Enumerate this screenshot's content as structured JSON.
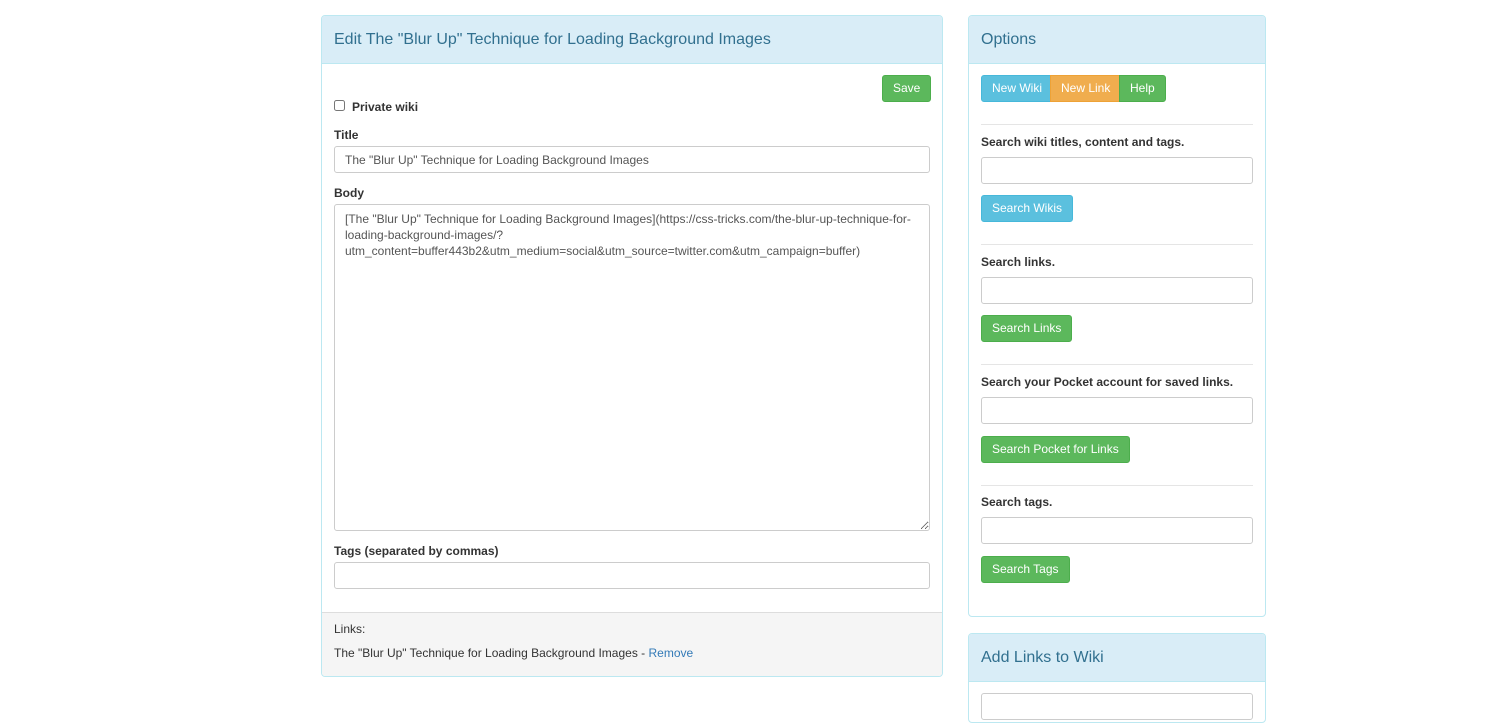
{
  "edit_panel": {
    "heading": "Edit The \"Blur Up\" Technique for Loading Background Images",
    "save_label": "Save",
    "private_label": "Private wiki",
    "title_label": "Title",
    "title_value": "The \"Blur Up\" Technique for Loading Background Images",
    "body_label": "Body",
    "body_value": "[The \"Blur Up\" Technique for Loading Background Images](https://css-tricks.com/the-blur-up-technique-for-loading-background-images/?utm_content=buffer443b2&utm_medium=social&utm_source=twitter.com&utm_campaign=buffer)",
    "tags_label": "Tags (separated by commas)",
    "tags_value": "",
    "links_label": "Links:",
    "link_item": "The \"Blur Up\" Technique for Loading Background Images - ",
    "remove_label": "Remove"
  },
  "options_panel": {
    "heading": "Options",
    "new_wiki": "New Wiki",
    "new_link": "New Link",
    "help": "Help",
    "search_wiki_label": "Search wiki titles, content and tags.",
    "search_wiki_button": "Search Wikis",
    "search_links_label": "Search links.",
    "search_links_button": "Search Links",
    "search_pocket_label": "Search your Pocket account for saved links.",
    "search_pocket_button": "Search Pocket for Links",
    "search_tags_label": "Search tags.",
    "search_tags_button": "Search Tags"
  },
  "add_links_panel": {
    "heading": "Add Links to Wiki"
  },
  "colors": {
    "heading_bg": "#d9edf7",
    "heading_text": "#31708f",
    "success": "#5cb85c",
    "info": "#5bc0de",
    "warning": "#f0ad4e",
    "link": "#337ab7"
  }
}
